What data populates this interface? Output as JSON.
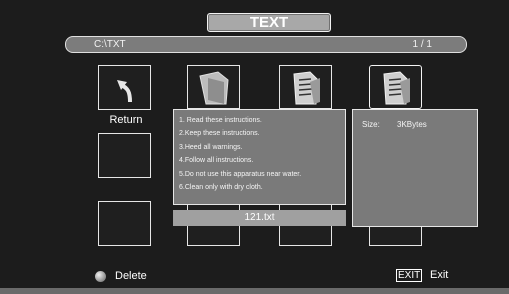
{
  "header": {
    "title": "TEXT"
  },
  "pathbar": {
    "path": "C:\\TXT",
    "page": "1 / 1"
  },
  "grid": {
    "return_label": "Return"
  },
  "preview": {
    "lines": [
      "1. Read these instructions.",
      "2.Keep these instructions.",
      "3.Heed all warnings.",
      "4.Follow all instructions.",
      "5.Do not use this apparatus near water.",
      "6.Clean only with dry cloth."
    ],
    "filename": "121.txt"
  },
  "info": {
    "size_label": "Size:",
    "size_value": "3KBytes"
  },
  "footer": {
    "delete_label": "Delete",
    "exit_key": "EXIT",
    "exit_label": "Exit"
  },
  "icons": {
    "return": "return-arrow-icon",
    "folder": "folder-icon",
    "text_file": "text-file-icon",
    "delete_dot": "grey-button-icon"
  }
}
